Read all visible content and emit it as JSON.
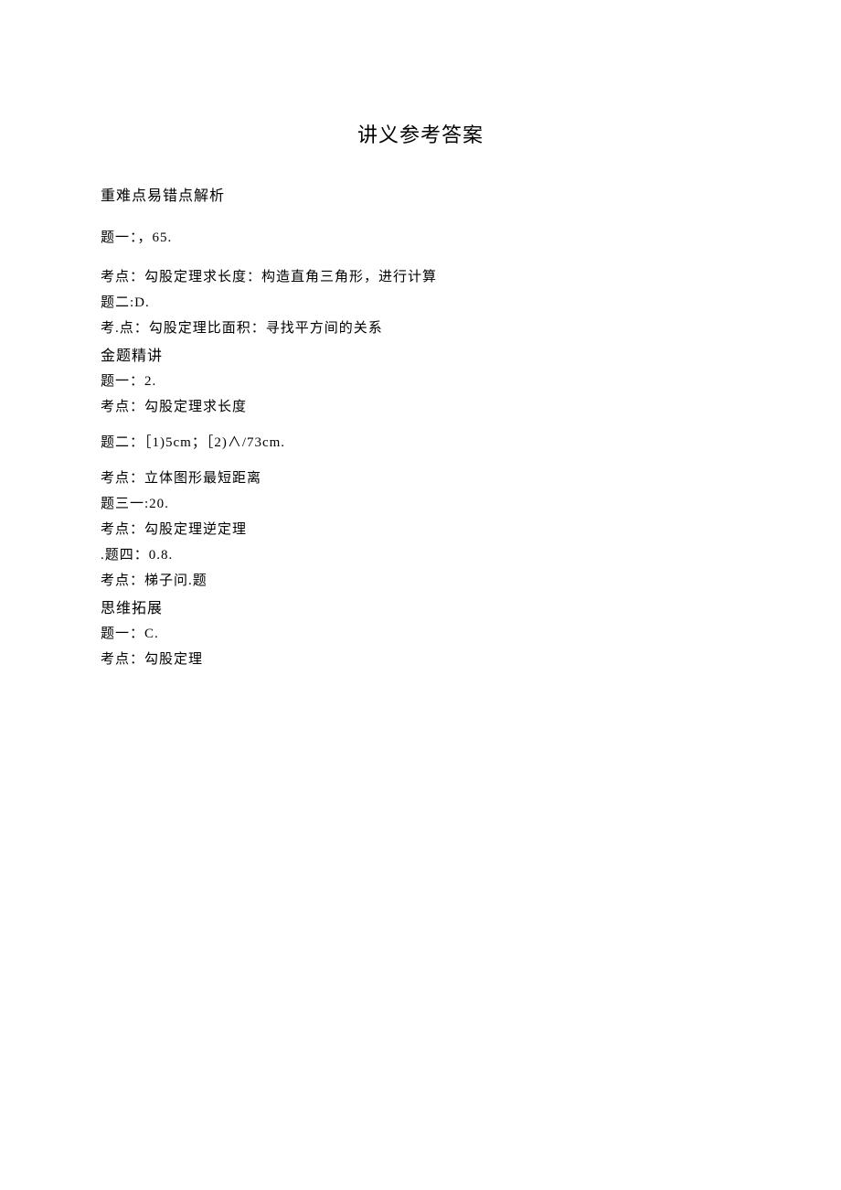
{
  "title": "讲义参考答案",
  "section1": {
    "heading": "重难点易错点解析",
    "q1": "题一：，65.",
    "q1_point": "考点：勾股定理求长度：构造直角三角形，进行计算",
    "q2": "题二:D.",
    "q2_point": "考.点：勾股定理比面积：寻找平方间的关系"
  },
  "section2": {
    "heading": "金题精讲",
    "q1": "题一：2.",
    "q1_point": "考点：勾股定理求长度",
    "q2": "题二：［1)5cm；［2)∧/73cm.",
    "q2_point": "考点：立体图形最短距离",
    "q3": "题三一:20.",
    "q3_point": "考点：勾股定理逆定理",
    "q4": ".题四：0.8.",
    "q4_point": "考点：梯子问.题"
  },
  "section3": {
    "heading": "思维拓展",
    "q1": "题一：C.",
    "q1_point": "考点：勾股定理"
  }
}
